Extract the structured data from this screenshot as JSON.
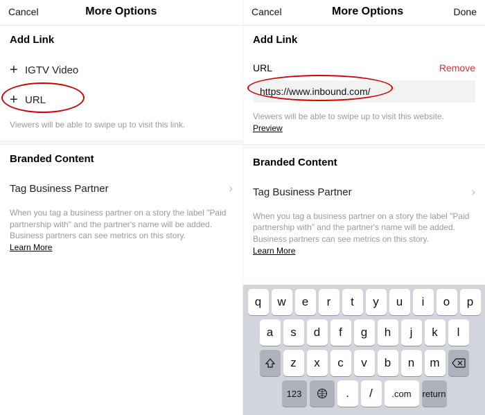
{
  "left": {
    "header": {
      "cancel": "Cancel",
      "title": "More Options"
    },
    "addlink": {
      "title": "Add Link",
      "igtv": "IGTV Video",
      "url": "URL",
      "hint": "Viewers will be able to swipe up to visit this link."
    },
    "branded": {
      "title": "Branded Content",
      "tag": "Tag Business Partner",
      "hint": "When you tag a business partner on a story the label \"Paid partnership with\" and the partner's name will be added. Business partners can see metrics on this story.",
      "learn": "Learn More"
    }
  },
  "right": {
    "header": {
      "cancel": "Cancel",
      "title": "More Options",
      "done": "Done"
    },
    "addlink": {
      "title": "Add Link",
      "url_label": "URL",
      "remove": "Remove",
      "url_value": "https://www.inbound.com/",
      "hint": "Viewers will be able to swipe up to visit this website.",
      "preview": "Preview"
    },
    "branded": {
      "title": "Branded Content",
      "tag": "Tag Business Partner",
      "hint": "When you tag a business partner on a story the label \"Paid partnership with\" and the partner's name will be added. Business partners can see metrics on this story.",
      "learn": "Learn More"
    },
    "keyboard": {
      "r1": [
        "q",
        "w",
        "e",
        "r",
        "t",
        "y",
        "u",
        "i",
        "o",
        "p"
      ],
      "r2": [
        "a",
        "s",
        "d",
        "f",
        "g",
        "h",
        "j",
        "k",
        "l"
      ],
      "r3": [
        "z",
        "x",
        "c",
        "v",
        "b",
        "n",
        "m"
      ],
      "fn": {
        "num": "123",
        "dot": ".",
        "slash": "/",
        "com": ".com",
        "ret": "return"
      }
    }
  }
}
